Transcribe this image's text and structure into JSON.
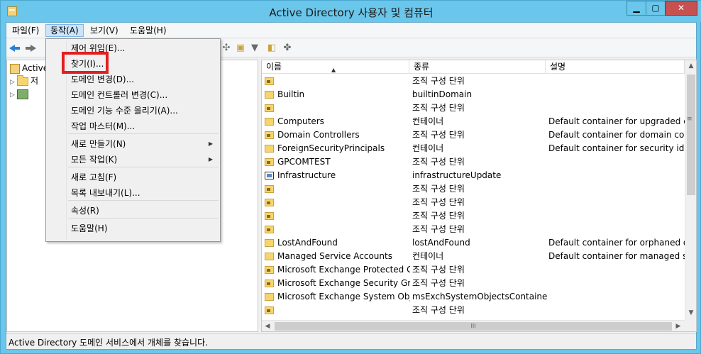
{
  "window": {
    "title": "Active Directory 사용자 및 컴퓨터",
    "controls": {
      "minimize": "▁",
      "maximize": "▢",
      "close": "✕"
    }
  },
  "menubar": {
    "items": [
      "파일(F)",
      "동작(A)",
      "보기(V)",
      "도움말(H)"
    ],
    "active": "동작(A)"
  },
  "toolbar": {
    "icons": [
      "back-arrow-icon",
      "forward-arrow-icon",
      "new-user-icon",
      "new-group-icon",
      "new-ou-icon",
      "filter-icon",
      "find-icon",
      "delegate-icon"
    ]
  },
  "tree": {
    "items": [
      {
        "label": "Active",
        "icon": "ad-root-icon"
      },
      {
        "label": "저",
        "icon": "folder-icon"
      },
      {
        "label": "",
        "icon": "domain-icon"
      }
    ]
  },
  "dropdown": {
    "items": [
      {
        "label": "제어 위임(E)...",
        "arrow": ""
      },
      {
        "label": "찾기(I)...",
        "arrow": ""
      },
      {
        "label": "도메인 변경(D)...",
        "arrow": ""
      },
      {
        "label": "도메인 컨트롤러 변경(C)...",
        "arrow": ""
      },
      {
        "label": "도메인 기능 수준 올리기(A)...",
        "arrow": ""
      },
      {
        "label": "작업 마스터(M)...",
        "arrow": ""
      },
      {
        "label": "새로 만들기(N)",
        "arrow": "▶"
      },
      {
        "label": "모든 작업(K)",
        "arrow": "▶"
      },
      {
        "label": "새로 고침(F)",
        "arrow": ""
      },
      {
        "label": "목록 내보내기(L)...",
        "arrow": ""
      },
      {
        "label": "속성(R)",
        "arrow": ""
      },
      {
        "label": "도움말(H)",
        "arrow": ""
      }
    ],
    "highlighted": "찾기(I)...",
    "highlight_color": "#e02020"
  },
  "list": {
    "columns": [
      "이름",
      "종류",
      "설명"
    ],
    "sort_indicator": "▲",
    "rows": [
      {
        "icon": "ou",
        "name": "",
        "type": "조직 구성 단위",
        "desc": ""
      },
      {
        "icon": "container",
        "name": "Builtin",
        "type": "builtinDomain",
        "desc": ""
      },
      {
        "icon": "ou",
        "name": "",
        "type": "조직 구성 단위",
        "desc": ""
      },
      {
        "icon": "container",
        "name": "Computers",
        "type": "컨테이너",
        "desc": "Default container for upgraded com"
      },
      {
        "icon": "ou",
        "name": "Domain Controllers",
        "type": "조직 구성 단위",
        "desc": "Default container for domain contro"
      },
      {
        "icon": "container",
        "name": "ForeignSecurityPrincipals",
        "type": "컨테이너",
        "desc": "Default container for security identi"
      },
      {
        "icon": "ou",
        "name": "GPCOMTEST",
        "type": "조직 구성 단위",
        "desc": ""
      },
      {
        "icon": "infra",
        "name": "Infrastructure",
        "type": "infrastructureUpdate",
        "desc": ""
      },
      {
        "icon": "ou",
        "name": "",
        "type": "조직 구성 단위",
        "desc": ""
      },
      {
        "icon": "ou",
        "name": "",
        "type": "조직 구성 단위",
        "desc": ""
      },
      {
        "icon": "ou",
        "name": "",
        "type": "조직 구성 단위",
        "desc": ""
      },
      {
        "icon": "ou",
        "name": "",
        "type": "조직 구성 단위",
        "desc": ""
      },
      {
        "icon": "container",
        "name": "LostAndFound",
        "type": "lostAndFound",
        "desc": "Default container for orphaned obje"
      },
      {
        "icon": "container",
        "name": "Managed Service Accounts",
        "type": "컨테이너",
        "desc": "Default container for managed serv"
      },
      {
        "icon": "ou",
        "name": "Microsoft Exchange Protected G...",
        "type": "조직 구성 단위",
        "desc": ""
      },
      {
        "icon": "ou",
        "name": "Microsoft Exchange Security Gr...",
        "type": "조직 구성 단위",
        "desc": ""
      },
      {
        "icon": "container",
        "name": "Microsoft Exchange System Obj...",
        "type": "msExchSystemObjectsContainer",
        "desc": ""
      },
      {
        "icon": "ou",
        "name": "",
        "type": "조직 구성 단위",
        "desc": ""
      }
    ]
  },
  "scrollbars": {
    "v_up": "▲",
    "v_down": "▼",
    "v_grip": "≡",
    "h_left": "◀",
    "h_right": "▶",
    "h_grip": "III"
  },
  "status": {
    "text": "Active Directory 도메인 서비스에서 개체를 찾습니다."
  }
}
